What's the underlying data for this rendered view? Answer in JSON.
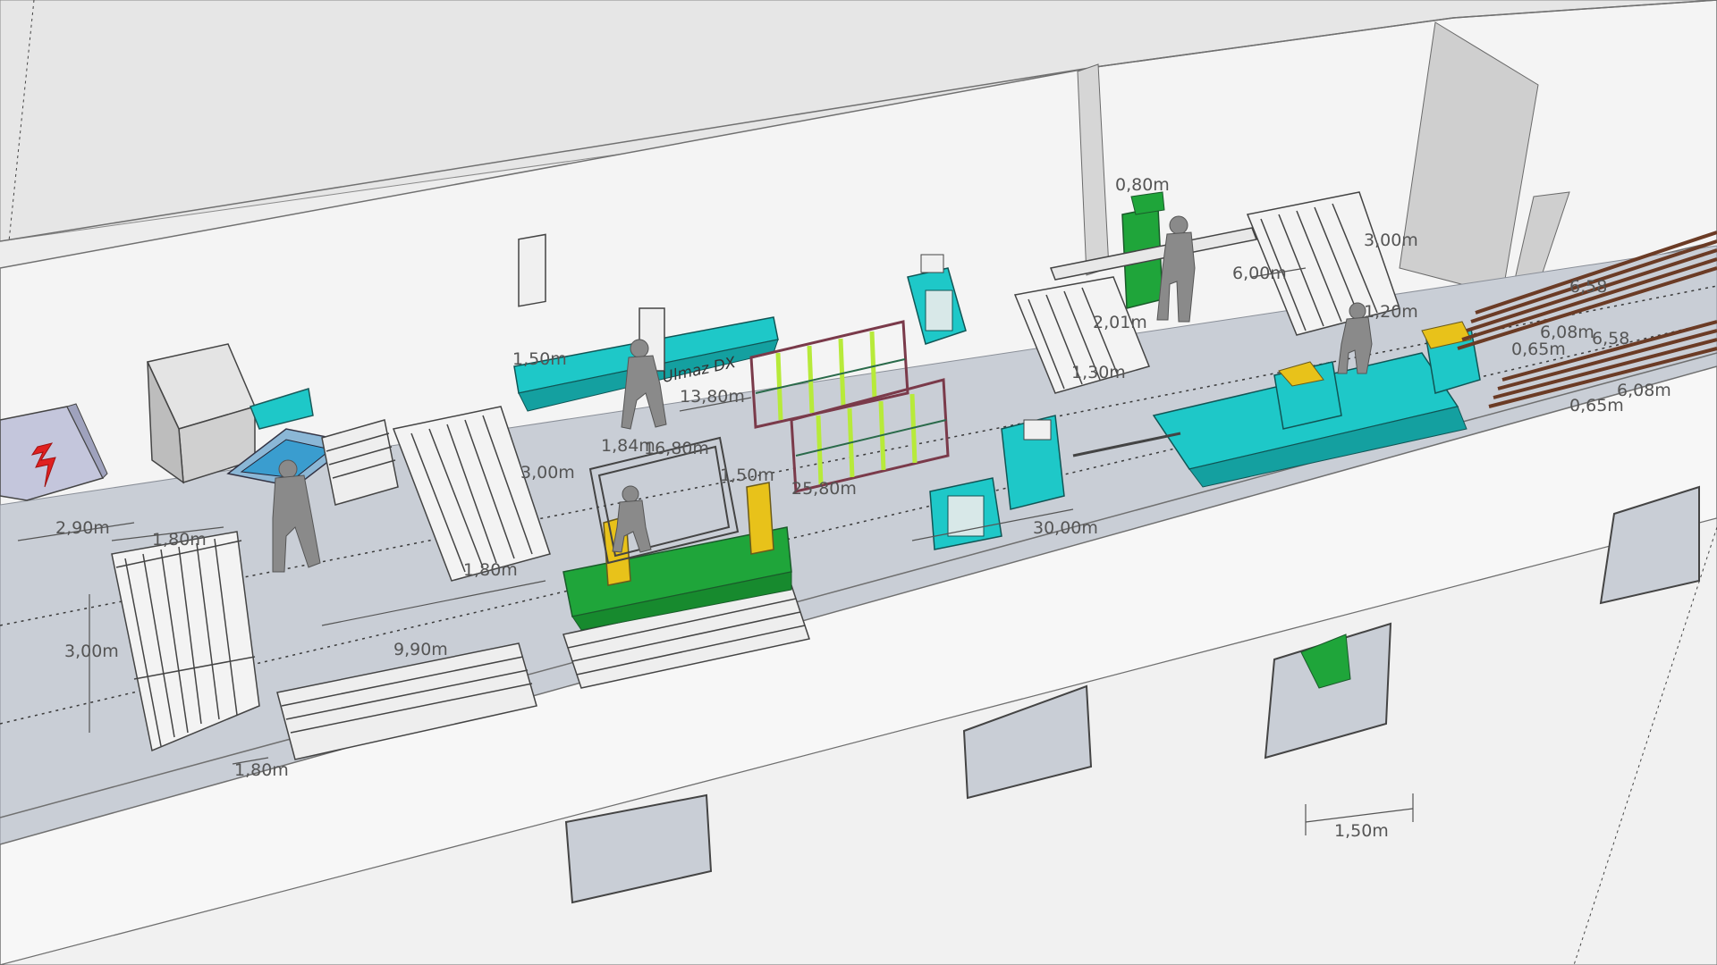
{
  "colors": {
    "background": "#ededed",
    "floor": "#c9ced6",
    "wall": "#f7f7f7",
    "wall_edge": "#606060",
    "machine_cyan": "#1ec8c8",
    "machine_green": "#1fa53a",
    "machine_yellow": "#e8c21a",
    "rack_green": "#b7ea3a",
    "rack_frame": "#7a3a4a",
    "profile_brown": "#6b3b25",
    "hazard_red": "#e02020",
    "dimension_text": "#555555"
  },
  "machine_label": "Ulmaz DX",
  "dimensions": {
    "d_290": "2,90m",
    "d_180_a": "1,80m",
    "d_180_b": "1,80m",
    "d_180_c": "1,80m",
    "d_300_a": "3,00m",
    "d_300_b": "3,00m",
    "d_300_c": "3,00m",
    "d_990": "9,90m",
    "d_150_a": "1,50m",
    "d_150_b": "1,50m",
    "d_150_c": "1,50m",
    "d_1380": "13,80m",
    "d_1680": "16,80m",
    "d_2580": "25,80m",
    "d_3000": "30,00m",
    "d_080": "0,80m",
    "d_600": "6,00m",
    "d_201": "2,01m",
    "d_130": "1,30m",
    "d_658_a": "6,58",
    "d_658_b": "6,58",
    "d_608_a": "6,08m",
    "d_608_b": "6,08m",
    "d_065_a": "0,65m",
    "d_065_b": "0,65m",
    "d_184": "1,84m",
    "d_120": "1,20m"
  }
}
